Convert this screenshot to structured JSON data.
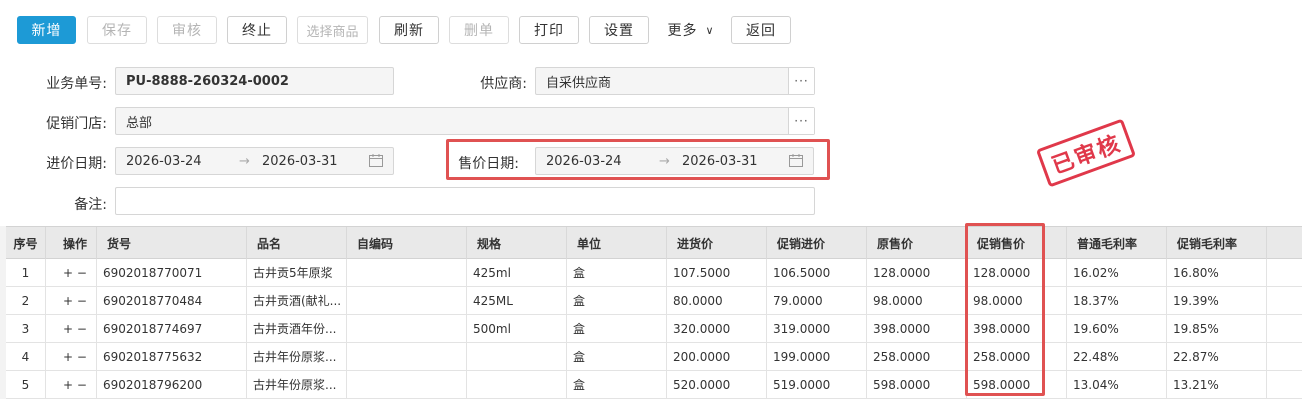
{
  "toolbar": {
    "add": "新增",
    "save": "保存",
    "audit": "审核",
    "terminate": "终止",
    "select_goods": "选择商品",
    "refresh": "刷新",
    "delete": "删单",
    "print": "打印",
    "settings": "设置",
    "more": "更多",
    "back": "返回"
  },
  "form": {
    "doc_no_label": "业务单号:",
    "doc_no": "PU-8888-260324-0002",
    "supplier_label": "供应商:",
    "supplier": "自采供应商",
    "store_label": "促销门店:",
    "store": "总部",
    "purchase_date_label": "进价日期:",
    "purchase_date_start": "2026-03-24",
    "purchase_date_end": "2026-03-31",
    "sale_date_label": "售价日期:",
    "sale_date_start": "2026-03-24",
    "sale_date_end": "2026-03-31",
    "remark_label": "备注:",
    "dots": "···",
    "arrow": "→"
  },
  "stamp": "已审核",
  "table": {
    "headers": [
      "序号",
      "操作",
      "货号",
      "品名",
      "自编码",
      "规格",
      "单位",
      "进货价",
      "促销进价",
      "原售价",
      "促销售价",
      "普通毛利率",
      "促销毛利率"
    ],
    "op_text": "+ −",
    "rows": [
      {
        "no": "1",
        "code": "6902018770071",
        "name": "古井贡5年原浆",
        "selfcode": "",
        "spec": "425ml",
        "unit": "盒",
        "cost": "107.5000",
        "promo_cost": "106.5000",
        "price": "128.0000",
        "promo_price": "128.0000",
        "margin": "16.02%",
        "promo_margin": "16.80%"
      },
      {
        "no": "2",
        "code": "6902018770484",
        "name": "古井贡酒(献礼...",
        "selfcode": "",
        "spec": "425ML",
        "unit": "盒",
        "cost": "80.0000",
        "promo_cost": "79.0000",
        "price": "98.0000",
        "promo_price": "98.0000",
        "margin": "18.37%",
        "promo_margin": "19.39%"
      },
      {
        "no": "3",
        "code": "6902018774697",
        "name": "古井贡酒年份...",
        "selfcode": "",
        "spec": "500ml",
        "unit": "盒",
        "cost": "320.0000",
        "promo_cost": "319.0000",
        "price": "398.0000",
        "promo_price": "398.0000",
        "margin": "19.60%",
        "promo_margin": "19.85%"
      },
      {
        "no": "4",
        "code": "6902018775632",
        "name": "古井年份原浆...",
        "selfcode": "",
        "spec": "",
        "unit": "盒",
        "cost": "200.0000",
        "promo_cost": "199.0000",
        "price": "258.0000",
        "promo_price": "258.0000",
        "margin": "22.48%",
        "promo_margin": "22.87%"
      },
      {
        "no": "5",
        "code": "6902018796200",
        "name": "古井年份原浆...",
        "selfcode": "",
        "spec": "",
        "unit": "盒",
        "cost": "520.0000",
        "promo_cost": "519.0000",
        "price": "598.0000",
        "promo_price": "598.0000",
        "margin": "13.04%",
        "promo_margin": "13.21%"
      }
    ]
  },
  "colors": {
    "primary": "#1d9ad6",
    "highlight": "#e05252",
    "stamp": "#e0384a"
  }
}
